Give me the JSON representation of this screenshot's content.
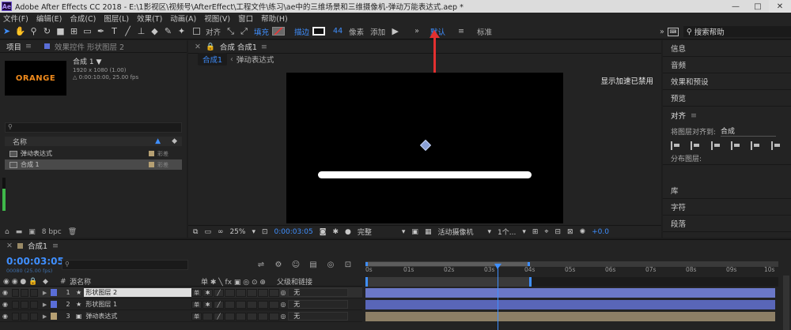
{
  "window": {
    "title": "Adobe After Effects CC 2018 - E:\\1影视区\\视频号\\AfterEffect\\工程文件\\练习\\ae中的三维场景和三维摄像机-弹动万能表达式.aep *",
    "logo": "Ae",
    "minimize": "—",
    "maximize": "□",
    "close": "✕"
  },
  "menu": [
    "文件(F)",
    "编辑(E)",
    "合成(C)",
    "图层(L)",
    "效果(T)",
    "动画(A)",
    "视图(V)",
    "窗口",
    "帮助(H)"
  ],
  "toolbar": {
    "align_label": "对齐",
    "fill_label": "填充",
    "stroke_label": "描边",
    "stroke_width": "44",
    "stroke_unit": "像素",
    "add_label": "添加",
    "workspace_default": "默认",
    "workspace_standard": "标准",
    "more": "»",
    "search_placeholder": "搜索帮助"
  },
  "project_panel": {
    "tab_project": "项目",
    "tab_effects": "效果控件 形状图层 2",
    "thumbnail_text": "ORANGE",
    "comp_name": "合成 1 ▼",
    "comp_size": "1920 x 1080 (1.00)",
    "comp_duration": "△ 0:00:10:00, 25.00 fps",
    "search_icon_text": "🔍",
    "col_name": "名称",
    "items": [
      {
        "name": "弹动表达式",
        "tag": "彩差"
      },
      {
        "name": "合成 1",
        "tag": "彩差"
      }
    ],
    "bpc": "8 bpc"
  },
  "viewer": {
    "tab_label": "合成 合成1",
    "sub_tab_active": "合成1",
    "sub_tab_other": "弹动表达式",
    "gpu_note": "显示加速已禁用",
    "zoom": "25%",
    "timecode": "0:00:03:05",
    "quality": "完整",
    "camera": "活动摄像机",
    "views": "1个...",
    "exposure": "+0.0"
  },
  "right_panels": {
    "info": "信息",
    "audio": "音频",
    "effects_presets": "效果和预设",
    "preview": "预览",
    "align_title": "对齐",
    "align_to_label": "将图层对齐到:",
    "align_to_value": "合成",
    "distribute": "分布图层:",
    "library": "库",
    "character": "字符",
    "paragraph": "段落"
  },
  "timeline": {
    "tab": "合成1",
    "timecode": "0:00:03:05",
    "fps_info": "00080 (25.00 fps)",
    "col_source": "源名称",
    "col_parent": "父级和链接",
    "ticks": [
      "0s",
      "01s",
      "02s",
      "03s",
      "04s",
      "05s",
      "06s",
      "07s",
      "08s",
      "09s",
      "10s"
    ],
    "layers": [
      {
        "num": "1",
        "name": "形状图层 2",
        "parent": "无",
        "label": "#5a6ed8",
        "bar": "#6b78c8"
      },
      {
        "num": "2",
        "name": "形状图层 1",
        "parent": "无",
        "label": "#5a6ed8",
        "bar": "#5966b8"
      },
      {
        "num": "3",
        "name": "弹动表达式",
        "parent": "无",
        "label": "#b6a073",
        "bar": "#8d7f66"
      }
    ]
  }
}
